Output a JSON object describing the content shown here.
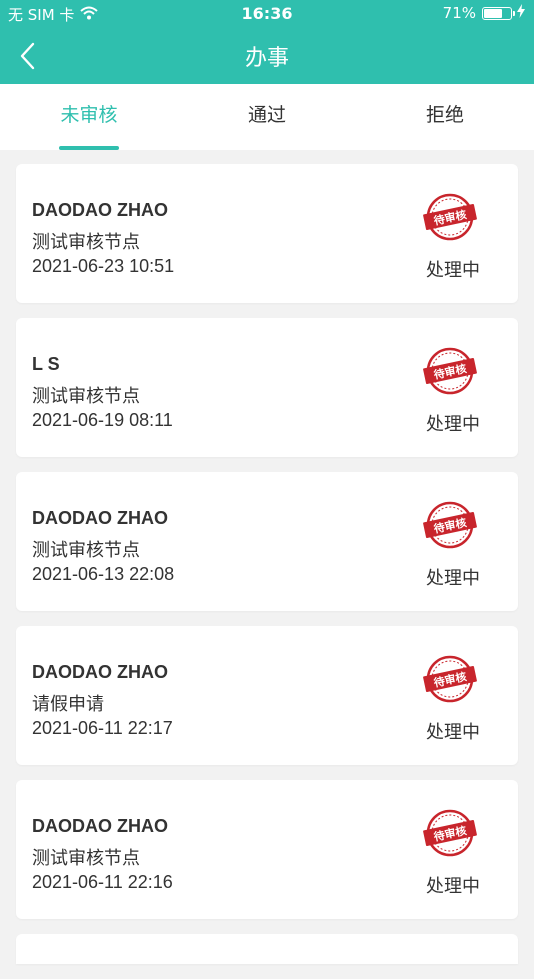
{
  "status_bar": {
    "carrier": "无 SIM 卡",
    "time": "16:36",
    "battery_percent": "71%",
    "battery_level": 0.71
  },
  "nav": {
    "title": "办事"
  },
  "tabs": [
    {
      "label": "未审核",
      "active": true
    },
    {
      "label": "通过",
      "active": false
    },
    {
      "label": "拒绝",
      "active": false
    }
  ],
  "stamp_text": "待审核",
  "items": [
    {
      "name": "DAODAO ZHAO",
      "node": "测试审核节点",
      "time": "2021-06-23 10:51",
      "status": "处理中"
    },
    {
      "name": "L S",
      "node": "测试审核节点",
      "time": "2021-06-19 08:11",
      "status": "处理中"
    },
    {
      "name": "DAODAO ZHAO",
      "node": "测试审核节点",
      "time": "2021-06-13 22:08",
      "status": "处理中"
    },
    {
      "name": "DAODAO ZHAO",
      "node": "请假申请",
      "time": "2021-06-11 22:17",
      "status": "处理中"
    },
    {
      "name": "DAODAO ZHAO",
      "node": "测试审核节点",
      "time": "2021-06-11 22:16",
      "status": "处理中"
    }
  ],
  "colors": {
    "accent": "#2fbfae",
    "stamp": "#c8252c"
  }
}
